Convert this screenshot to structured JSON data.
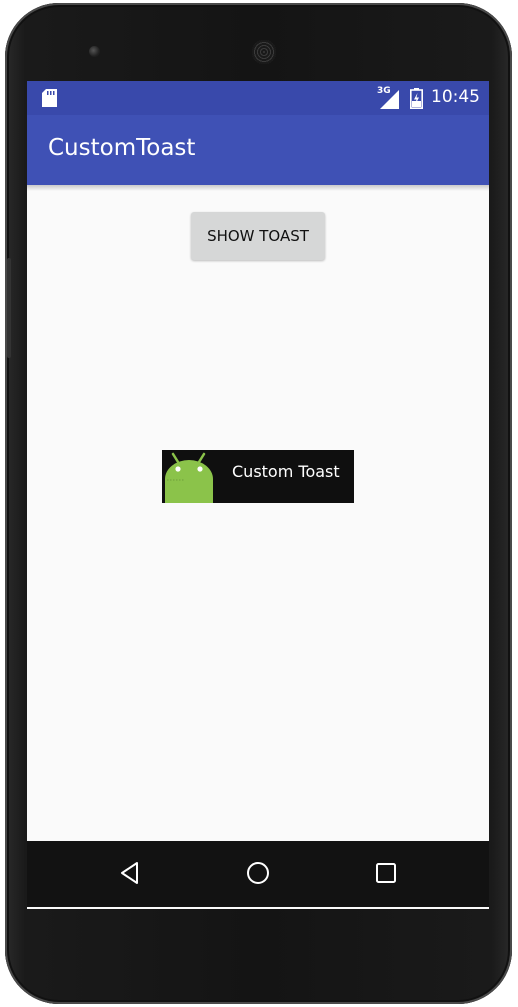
{
  "status_bar": {
    "time": "10:45",
    "network_label": "3G",
    "icons": [
      "sd-card-icon",
      "signal-3g-icon",
      "battery-charging-icon"
    ]
  },
  "app_bar": {
    "title": "CustomToast",
    "color": "#3f51b5",
    "status_color": "#3949ab"
  },
  "main": {
    "show_toast_label": "SHOW TOAST"
  },
  "toast": {
    "text": "Custom Toast",
    "icon": "android-robot-icon",
    "icon_color": "#8bc34a"
  },
  "navigation": {
    "buttons": [
      "back-icon",
      "home-icon",
      "recents-icon"
    ]
  }
}
